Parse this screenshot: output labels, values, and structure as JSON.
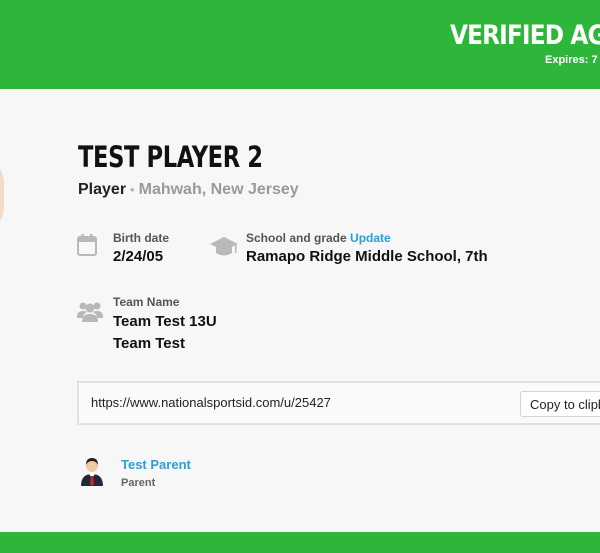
{
  "header": {
    "verified_label": "VERIFIED AGE:",
    "expires_label": "Expires: 7"
  },
  "profile": {
    "name": "TEST PLAYER 2",
    "role": "Player",
    "separator": "•",
    "location": "Mahwah, New Jersey",
    "birth_date": {
      "label": "Birth date",
      "value": "2/24/05",
      "icon": "calendar-icon"
    },
    "school": {
      "label": "School and grade",
      "update_link": "Update",
      "value": "Ramapo Ridge Middle School, 7th",
      "icon": "graduation-cap-icon"
    },
    "team": {
      "label": "Team Name",
      "values": [
        "Team Test 13U",
        "Team Test"
      ],
      "icon": "group-icon"
    },
    "profile_url": "https://www.nationalsportsid.com/u/25427",
    "copy_button": "Copy to clipboard",
    "parent": {
      "name": "Test Parent",
      "role": "Parent",
      "icon": "parent-avatar-icon"
    }
  },
  "colors": {
    "brand_green": "#2db63a",
    "link_blue": "#2a9fd6",
    "icon_gray": "#b8b8b8"
  }
}
